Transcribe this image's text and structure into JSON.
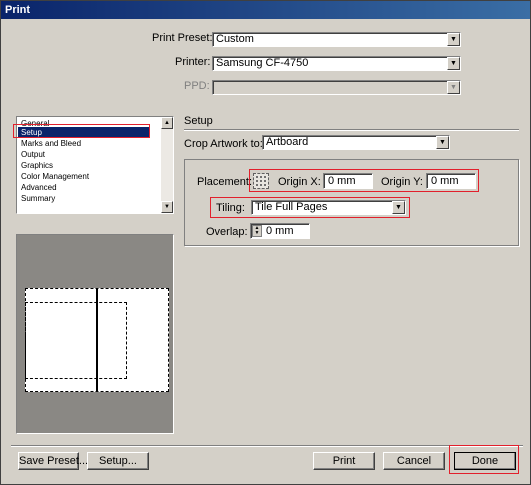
{
  "window": {
    "title": "Print"
  },
  "top": {
    "print_preset": {
      "label": "Print Preset:",
      "value": "Custom"
    },
    "printer": {
      "label": "Printer:",
      "value": "Samsung CF-4750"
    },
    "ppd": {
      "label": "PPD:",
      "value": ""
    }
  },
  "categories": {
    "items": [
      {
        "label": "General"
      },
      {
        "label": "Setup"
      },
      {
        "label": "Marks and Bleed"
      },
      {
        "label": "Output"
      },
      {
        "label": "Graphics"
      },
      {
        "label": "Color Management"
      },
      {
        "label": "Advanced"
      },
      {
        "label": "Summary"
      }
    ],
    "selected": "Setup"
  },
  "setup": {
    "heading": "Setup",
    "crop_artwork": {
      "label": "Crop Artwork to:",
      "value": "Artboard"
    },
    "placement": {
      "label": "Placement:"
    },
    "origin_x": {
      "label": "Origin X:",
      "value": "0 mm"
    },
    "origin_y": {
      "label": "Origin Y:",
      "value": "0 mm"
    },
    "tiling": {
      "label": "Tiling:",
      "value": "Tile Full Pages"
    },
    "overlap": {
      "label": "Overlap:",
      "value": "0 mm"
    }
  },
  "buttons": {
    "save_preset": "Save Preset...",
    "setup": "Setup...",
    "print": "Print",
    "cancel": "Cancel",
    "done": "Done"
  },
  "colors": {
    "highlight": "#e2202c",
    "selection": "#0a246a",
    "dialog": "#d4d0c8"
  },
  "icons": {
    "placement": "placement-grid-icon",
    "dropdown": "dropdown-arrow-icon",
    "stepper": "stepper-icon"
  }
}
